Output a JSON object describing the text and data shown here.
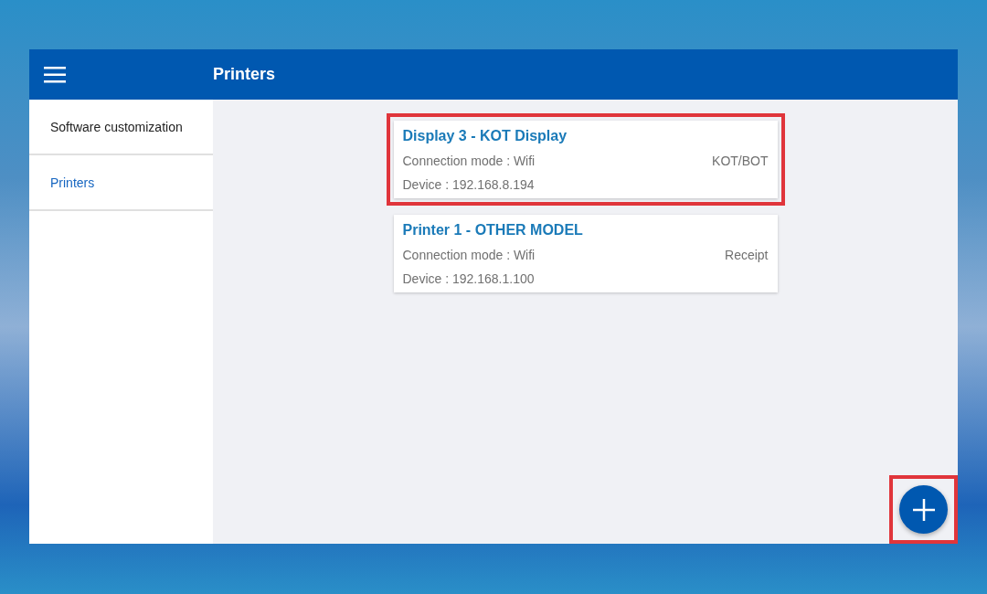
{
  "app_bar": {
    "title": "Printers"
  },
  "sidebar": {
    "items": [
      {
        "label": "Software customization",
        "selected": false
      },
      {
        "label": "Printers",
        "selected": true
      }
    ]
  },
  "printers": [
    {
      "name": "Display 3 - KOT Display",
      "connection": "Connection mode : Wifi",
      "device": "Device : 192.168.8.194",
      "type": "KOT/BOT",
      "highlighted": true
    },
    {
      "name": "Printer 1 - OTHER MODEL",
      "connection": "Connection mode : Wifi",
      "device": "Device : 192.168.1.100",
      "type": "Receipt",
      "highlighted": false
    }
  ],
  "add_button": {
    "highlighted": true
  }
}
